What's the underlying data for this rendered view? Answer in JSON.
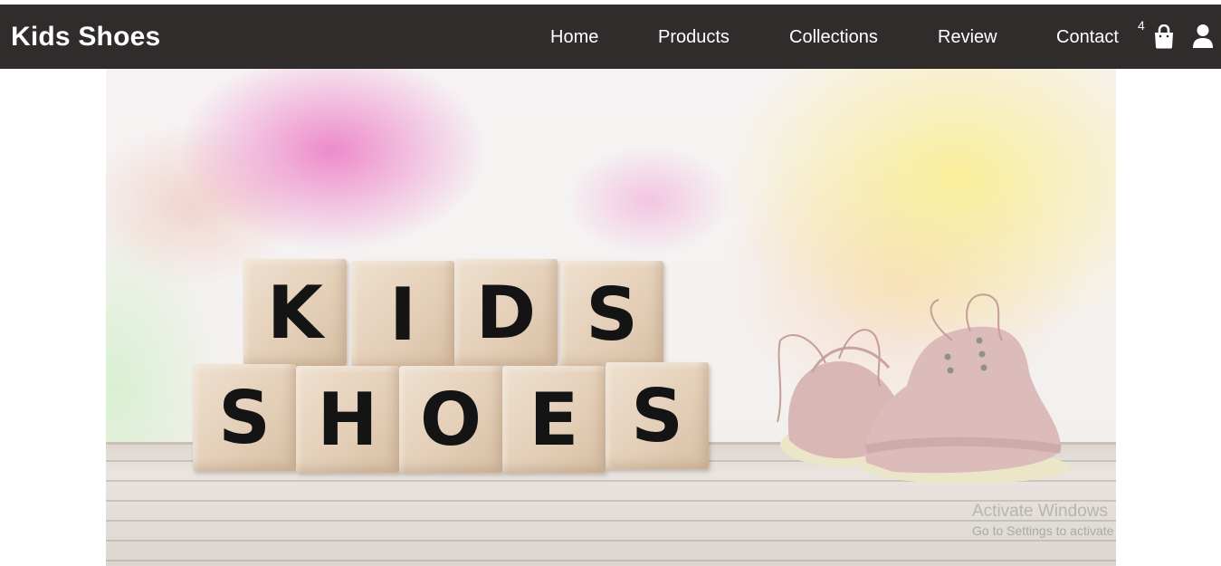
{
  "brand": {
    "title": "Kids Shoes"
  },
  "nav": {
    "items": [
      {
        "label": "Home"
      },
      {
        "label": "Products"
      },
      {
        "label": "Collections"
      },
      {
        "label": "Review"
      },
      {
        "label": "Contact"
      }
    ],
    "cart_count": "4",
    "cart_icon": "shopping-bag-icon",
    "user_icon": "user-icon"
  },
  "hero": {
    "blocks_top": [
      "K",
      "I",
      "D",
      "S"
    ],
    "blocks_bottom": [
      "S",
      "H",
      "O",
      "E",
      "S"
    ]
  },
  "os_watermark": {
    "title": "Activate Windows",
    "subtitle": "Go to Settings to activate Windows."
  },
  "colors": {
    "navbar_bg": "#302c2c",
    "nav_text": "#ffffff"
  }
}
